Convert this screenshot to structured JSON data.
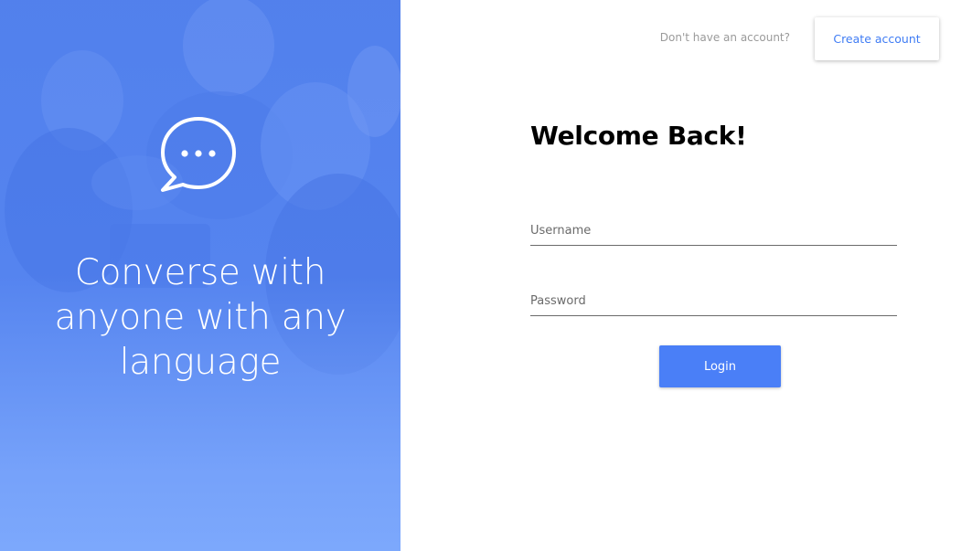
{
  "hero": {
    "tagline": "Converse with anyone with any language",
    "icon": "chat-bubble-ellipsis-icon",
    "accent_color": "#4f7ff0"
  },
  "header": {
    "prompt_text": "Don't have an account?",
    "create_account_label": "Create account"
  },
  "login_form": {
    "title": "Welcome Back!",
    "username_placeholder": "Username",
    "password_placeholder": "Password",
    "login_label": "Login",
    "button_color": "#4a7ff7"
  }
}
